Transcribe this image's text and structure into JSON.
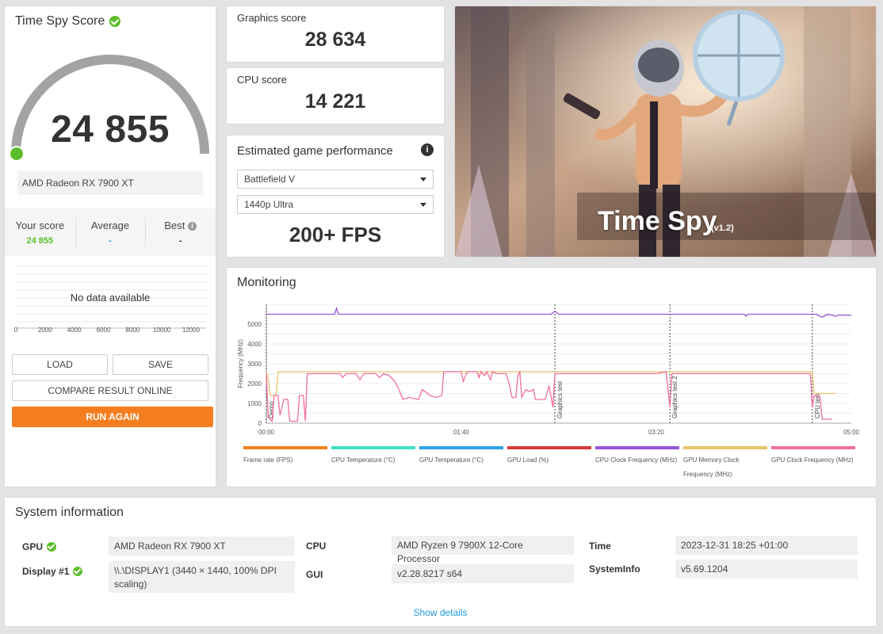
{
  "score_card": {
    "title": "Time Spy Score",
    "score": "24 855",
    "gpu": "AMD Radeon RX 7900 XT",
    "compare": {
      "your_label": "Your score",
      "your_value": "24 855",
      "avg_label": "Average",
      "avg_value": "-",
      "best_label": "Best",
      "best_value": "-"
    },
    "no_data": "No data available",
    "axis_ticks": [
      "0",
      "2000",
      "4000",
      "6000",
      "8000",
      "10000",
      "12000"
    ],
    "buttons": {
      "load": "LOAD",
      "save": "SAVE",
      "compare": "COMPARE RESULT ONLINE",
      "run_again": "RUN AGAIN"
    }
  },
  "graphics": {
    "label": "Graphics score",
    "value": "28 634"
  },
  "cpu": {
    "label": "CPU score",
    "value": "14 221"
  },
  "estimated": {
    "title": "Estimated game performance",
    "game": "Battlefield V",
    "preset": "1440p Ultra",
    "fps": "200+ FPS"
  },
  "hero": {
    "title": "Time Spy",
    "version": "(v1.2)"
  },
  "monitoring": {
    "title": "Monitoring",
    "ylabel": "Frequency (MHz)",
    "y_ticks": [
      "0",
      "1000",
      "2000",
      "3000",
      "4000",
      "5000"
    ],
    "x_ticks": [
      "00:00",
      "01:40",
      "03:20",
      "05:00"
    ],
    "markers": [
      "Demo",
      "Graphics test",
      "Graphics test 2",
      "CPU test"
    ],
    "legend": [
      {
        "label": "Frame rate (FPS)",
        "color": "#f47e1f"
      },
      {
        "label": "CPU Temperature (°C)",
        "color": "#3fe0c5"
      },
      {
        "label": "GPU Temperature (°C)",
        "color": "#2aa3e6"
      },
      {
        "label": "GPU Load (%)",
        "color": "#d93a3a"
      },
      {
        "label": "CPU Clock Frequency (MHz)",
        "color": "#9a55d6"
      },
      {
        "label": "GPU Memory Clock Frequency (MHz)",
        "color": "#e8c46a"
      },
      {
        "label": "GPU Clock Frequency (MHz)",
        "color": "#ef6fa0"
      }
    ]
  },
  "system": {
    "title": "System information",
    "gpu_label": "GPU",
    "gpu_value": "AMD Radeon RX 7900 XT",
    "display_label": "Display #1",
    "display_value": "\\\\.\\DISPLAY1 (3440 × 1440, 100% DPI scaling)",
    "cpu_label": "CPU",
    "cpu_value": "AMD Ryzen 9 7900X 12-Core Processor",
    "gui_label": "GUI",
    "gui_value": "v2.28.8217 s64",
    "time_label": "Time",
    "time_value": "2023-12-31 18:25 +01:00",
    "sysinfo_label": "SystemInfo",
    "sysinfo_value": "v5.69.1204",
    "show_details": "Show details"
  }
}
